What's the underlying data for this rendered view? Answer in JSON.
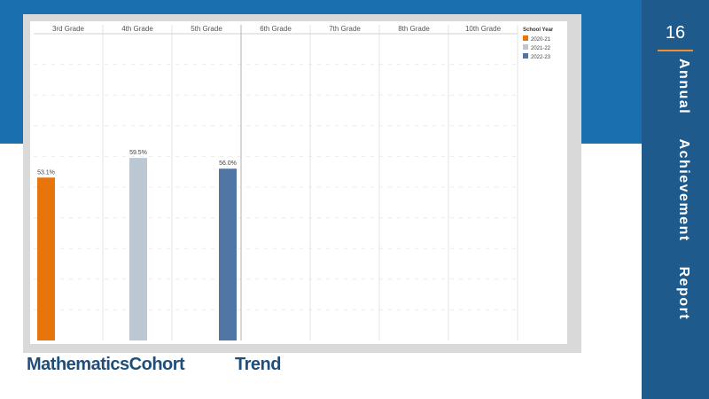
{
  "slide": {
    "page_number": "16",
    "side_title": "Annual Achievement Report",
    "caption_left": "MathematicsCohort",
    "caption_right": "Trend"
  },
  "colors": {
    "top_band": "#1a6fae",
    "side_panel": "#1e5b8c",
    "accent_rule": "#f08f2e",
    "caption": "#1f4e79"
  },
  "chart_data": {
    "type": "bar",
    "categories": [
      "3rd Grade",
      "4th Grade",
      "5th Grade",
      "6th Grade",
      "7th Grade",
      "8th Grade",
      "10th Grade"
    ],
    "legend_title": "School Year",
    "legend_position": "top-right",
    "series": [
      {
        "name": "2020-21",
        "color": "#e8740c",
        "values": [
          53.1,
          null,
          null,
          null,
          null,
          null,
          null
        ],
        "labels": [
          "53.1%",
          null,
          null,
          null,
          null,
          null,
          null
        ]
      },
      {
        "name": "2021-22",
        "color": "#bcc7d4",
        "values": [
          null,
          59.5,
          null,
          null,
          null,
          null,
          null
        ],
        "labels": [
          null,
          "59.5%",
          null,
          null,
          null,
          null,
          null
        ]
      },
      {
        "name": "2022-23",
        "color": "#4f76a4",
        "values": [
          null,
          null,
          56.0,
          null,
          null,
          null,
          null
        ],
        "labels": [
          null,
          null,
          "56.0%",
          null,
          null,
          null,
          null
        ]
      }
    ],
    "ylim": [
      0,
      100
    ],
    "grid": true
  }
}
